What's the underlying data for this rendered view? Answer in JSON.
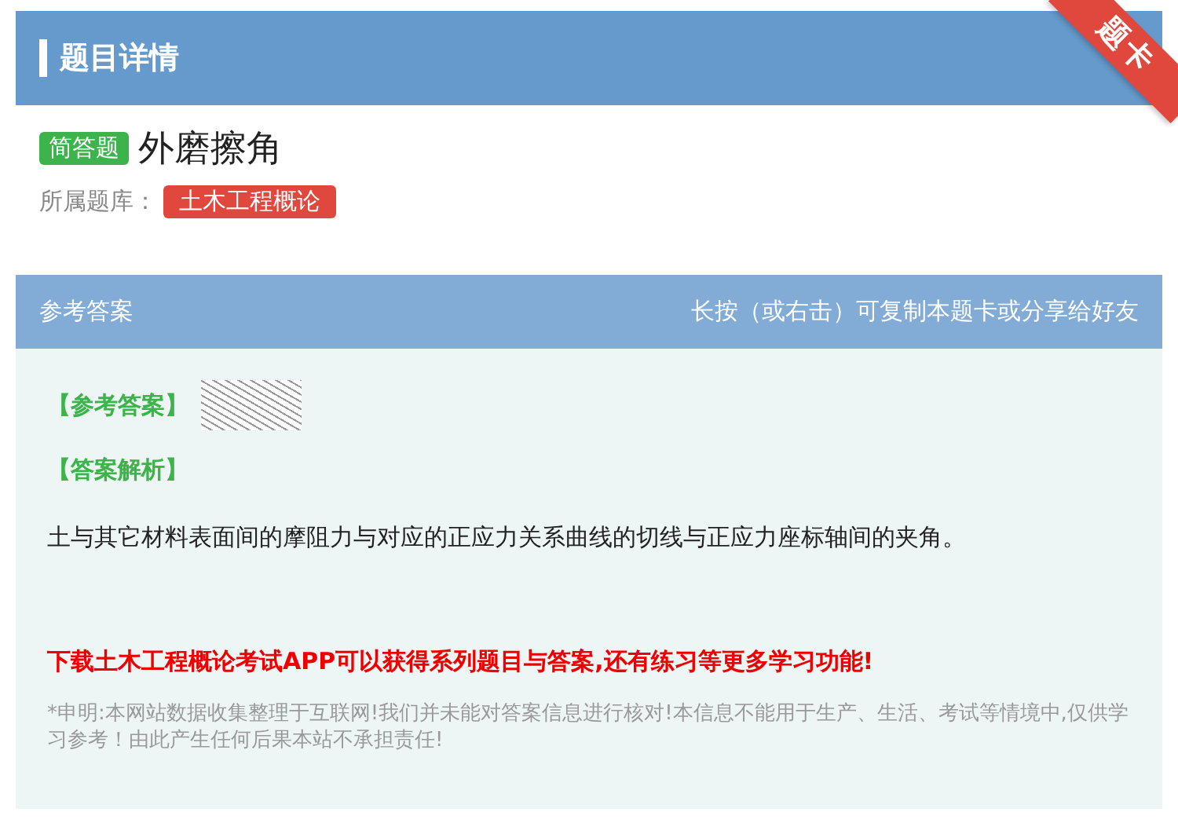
{
  "header": {
    "title": "题目详情",
    "ribbon": "题卡"
  },
  "question": {
    "type_badge": "简答题",
    "title": "外磨擦角",
    "bank_label": "所属题库：",
    "bank": "土木工程概论"
  },
  "answer_panel": {
    "title": "参考答案",
    "hint": "长按（或右击）可复制本题卡或分享给好友",
    "answer_label": "【参考答案】",
    "analysis_label": "【答案解析】",
    "analysis": "土与其它材料表面间的摩阻力与对应的正应力关系曲线的切线与正应力座标轴间的夹角。",
    "promo": "下载土木工程概论考试APP可以获得系列题目与答案,还有练习等更多学习功能!",
    "disclaimer": "*申明:本网站数据收集整理于互联网!我们并未能对答案信息进行核对!本信息不能用于生产、生活、考试等情境中,仅供学习参考！由此产生任何后果本站不承担责任!"
  }
}
